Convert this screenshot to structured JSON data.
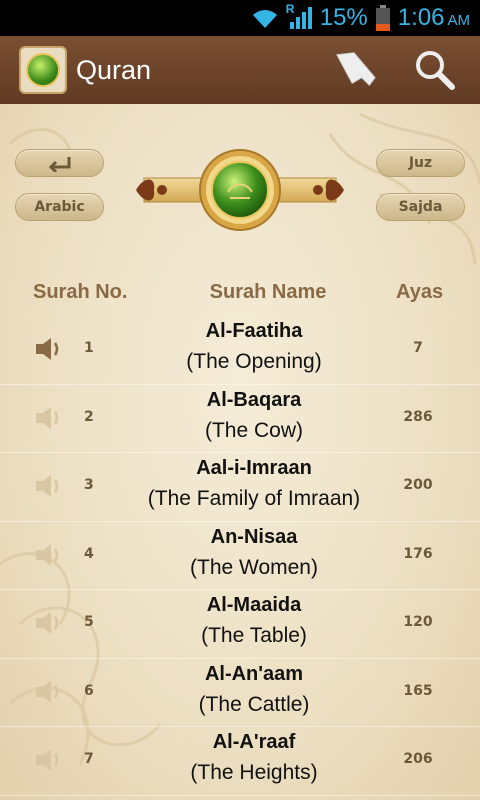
{
  "status_bar": {
    "battery_percent": "15%",
    "time": "1:06",
    "ampm": "AM",
    "roaming_label": "R",
    "accent": "#35b5e5"
  },
  "action_bar": {
    "title": "Quran",
    "icons": [
      "app-logo",
      "bookmark-icon",
      "search-icon"
    ],
    "background": "#6b4429"
  },
  "top_buttons": {
    "back_icon": "back-arrow-icon",
    "arabic": "Arabic",
    "juz": "Juz",
    "sajda": "Sajda"
  },
  "table": {
    "headers": {
      "number": "Surah No.",
      "name": "Surah Name",
      "ayas": "Ayas"
    },
    "rows": [
      {
        "number": "1",
        "name": "Al-Faatiha",
        "translation": "(The Opening)",
        "ayas": "7",
        "audio_active": true
      },
      {
        "number": "2",
        "name": "Al-Baqara",
        "translation": "(The Cow)",
        "ayas": "286",
        "audio_active": false
      },
      {
        "number": "3",
        "name": "Aal-i-Imraan",
        "translation": "(The Family of Imraan)",
        "ayas": "200",
        "audio_active": false
      },
      {
        "number": "4",
        "name": "An-Nisaa",
        "translation": "(The Women)",
        "ayas": "176",
        "audio_active": false
      },
      {
        "number": "5",
        "name": "Al-Maaida",
        "translation": "(The Table)",
        "ayas": "120",
        "audio_active": false
      },
      {
        "number": "6",
        "name": "Al-An'aam",
        "translation": "(The Cattle)",
        "ayas": "165",
        "audio_active": false
      },
      {
        "number": "7",
        "name": "Al-A'raaf",
        "translation": "(The Heights)",
        "ayas": "206",
        "audio_active": false
      }
    ]
  }
}
